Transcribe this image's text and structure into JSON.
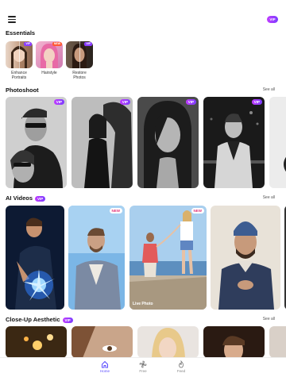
{
  "header": {
    "vip_label": "VIP"
  },
  "essentials": {
    "title": "Essentials",
    "items": [
      {
        "label": "Enhance\nPortraits",
        "badge": "VIP"
      },
      {
        "label": "Hairstyle",
        "badge": "NEW"
      },
      {
        "label": "Restore\nPhotos",
        "badge": "VIP"
      }
    ]
  },
  "photoshoot": {
    "title": "Photoshoot",
    "see_all": "See all",
    "cards": [
      "VIP",
      "VIP",
      "VIP",
      "VIP"
    ]
  },
  "ai_videos": {
    "title": "AI Videos",
    "badge": "VIP",
    "see_all": "See all",
    "cards": [
      {
        "badge": ""
      },
      {
        "badge": "NEW"
      },
      {
        "badge": "NEW",
        "caption": "Live Photo"
      },
      {
        "badge": ""
      }
    ]
  },
  "closeup": {
    "title": "Close-Up Aesthetic",
    "badge": "VIP",
    "see_all": "See all"
  },
  "nav": {
    "home": "Home",
    "free": "Free",
    "feed": "Feed"
  },
  "colors": {
    "accent": "#5b4dff",
    "vip_from": "#c13cff",
    "vip_to": "#7b3dff",
    "new_text": "#e2367a"
  }
}
